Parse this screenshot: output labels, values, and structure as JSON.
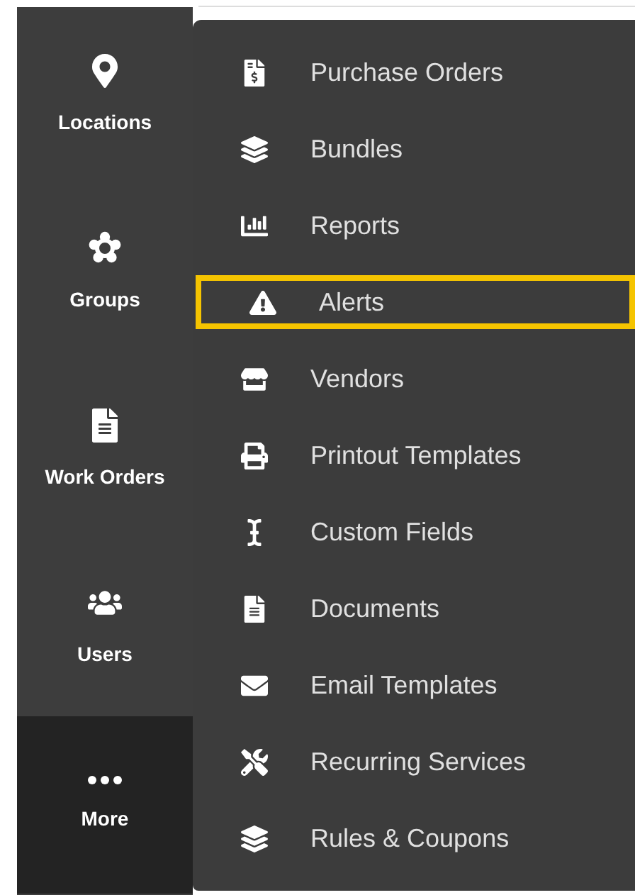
{
  "sidebar": {
    "items": [
      {
        "label": "Locations",
        "selected": false
      },
      {
        "label": "Groups",
        "selected": false
      },
      {
        "label": "Work Orders",
        "selected": false
      },
      {
        "label": "Users",
        "selected": false
      },
      {
        "label": "More",
        "selected": true
      }
    ]
  },
  "menu": {
    "items": [
      {
        "label": "Purchase Orders",
        "selected": false
      },
      {
        "label": "Bundles",
        "selected": false
      },
      {
        "label": "Reports",
        "selected": false
      },
      {
        "label": "Alerts",
        "selected": true
      },
      {
        "label": "Vendors",
        "selected": false
      },
      {
        "label": "Printout Templates",
        "selected": false
      },
      {
        "label": "Custom Fields",
        "selected": false
      },
      {
        "label": "Documents",
        "selected": false
      },
      {
        "label": "Email Templates",
        "selected": false
      },
      {
        "label": "Recurring Services",
        "selected": false
      },
      {
        "label": "Rules & Coupons",
        "selected": false
      }
    ]
  }
}
